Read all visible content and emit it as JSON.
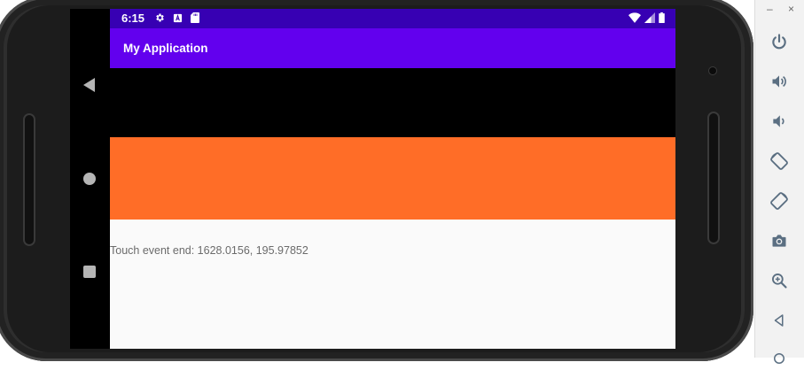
{
  "status_bar": {
    "time": "6:15",
    "left_icons": [
      "settings-icon",
      "text-input-icon",
      "sd-card-icon"
    ],
    "right_icons": [
      "wifi-icon",
      "signal-icon",
      "battery-icon"
    ]
  },
  "app_bar": {
    "title": "My Application"
  },
  "content": {
    "touch_text": "Touch event end: 1628.0156, 195.97852"
  },
  "nav_bar": [
    "back-icon",
    "home-icon",
    "recents-icon"
  ],
  "emulator_toolbar": {
    "window_controls": {
      "minimize": "–",
      "close": "×"
    },
    "buttons": [
      "power",
      "volume-up",
      "volume-down",
      "rotate-left",
      "rotate-right",
      "screenshot",
      "zoom",
      "back",
      "home"
    ]
  },
  "colors": {
    "status_bar": "#3700b3",
    "app_bar": "#6200ee",
    "orange_view": "#ff6d27",
    "content_bg": "#fafafa",
    "toolbar_icon": "#5b6f82"
  }
}
